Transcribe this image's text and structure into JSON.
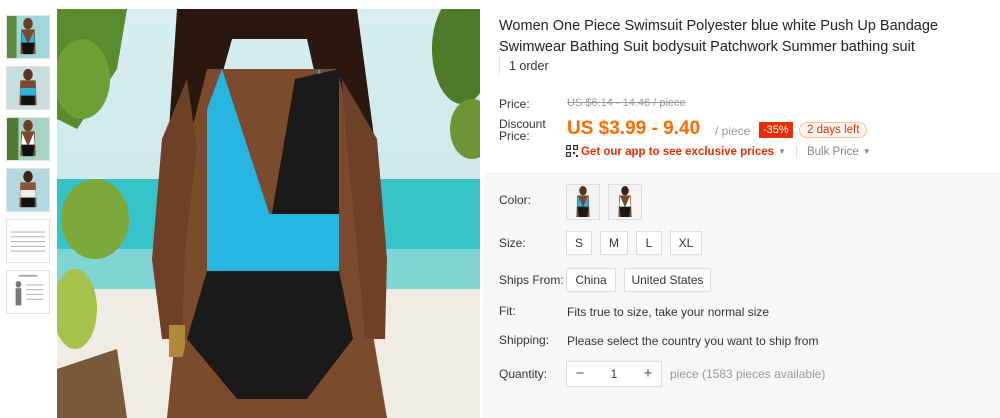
{
  "product": {
    "title": "Women One Piece Swimsuit Polyester blue white Push Up Bandage Swimwear Bathing Suit bodysuit Patchwork Summer bathing suit",
    "orders": "1 order"
  },
  "price": {
    "price_label": "Price:",
    "original": "US $6.14 - 14.46 / piece",
    "discount_label_line1": "Discount",
    "discount_label_line2": "Price:",
    "discount_price": "US $3.99 - 9.40",
    "per_piece": "/ piece",
    "discount_badge": "-35%",
    "days_left": "2 days left",
    "app_link": "Get our app to see exclusive prices",
    "bulk_price": "Bulk Price"
  },
  "options": {
    "color_label": "Color:",
    "size_label": "Size:",
    "sizes": [
      "S",
      "M",
      "L",
      "XL"
    ],
    "ships_from_label": "Ships From:",
    "ships_from": [
      "China",
      "United States"
    ],
    "fit_label": "Fit:",
    "fit_text": "Fits true to size, take your normal size",
    "shipping_label": "Shipping:",
    "shipping_text": "Please select the country you want to ship from",
    "quantity_label": "Quantity:",
    "quantity_value": "1",
    "quantity_minus": "−",
    "quantity_plus": "+",
    "availability": "piece (1583 pieces available)"
  },
  "colors": {
    "accent_orange": "#ff6a00",
    "badge_red": "#e62e04",
    "swimsuit_blue": "#27b6e2",
    "swimsuit_black": "#1a1a1a"
  }
}
